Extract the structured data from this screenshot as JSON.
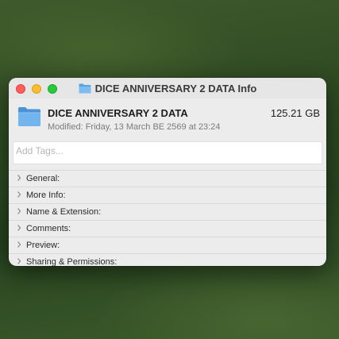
{
  "window": {
    "title": "DICE ANNIVERSARY 2 DATA Info",
    "title_icon": "folder-icon"
  },
  "header": {
    "name": "DICE ANNIVERSARY 2 DATA",
    "size": "125.21 GB",
    "modified": "Modified: Friday, 13 March BE 2569 at 23:24",
    "icon": "folder-icon"
  },
  "tags": {
    "placeholder": "Add Tags..."
  },
  "sections": [
    {
      "label": "General:"
    },
    {
      "label": "More Info:"
    },
    {
      "label": "Name & Extension:"
    },
    {
      "label": "Comments:"
    },
    {
      "label": "Preview:"
    },
    {
      "label": "Sharing & Permissions:"
    }
  ],
  "colors": {
    "close": "#fe5f57",
    "minimize": "#febc2e",
    "zoom": "#28c840",
    "folder": "#5aa3e0"
  }
}
